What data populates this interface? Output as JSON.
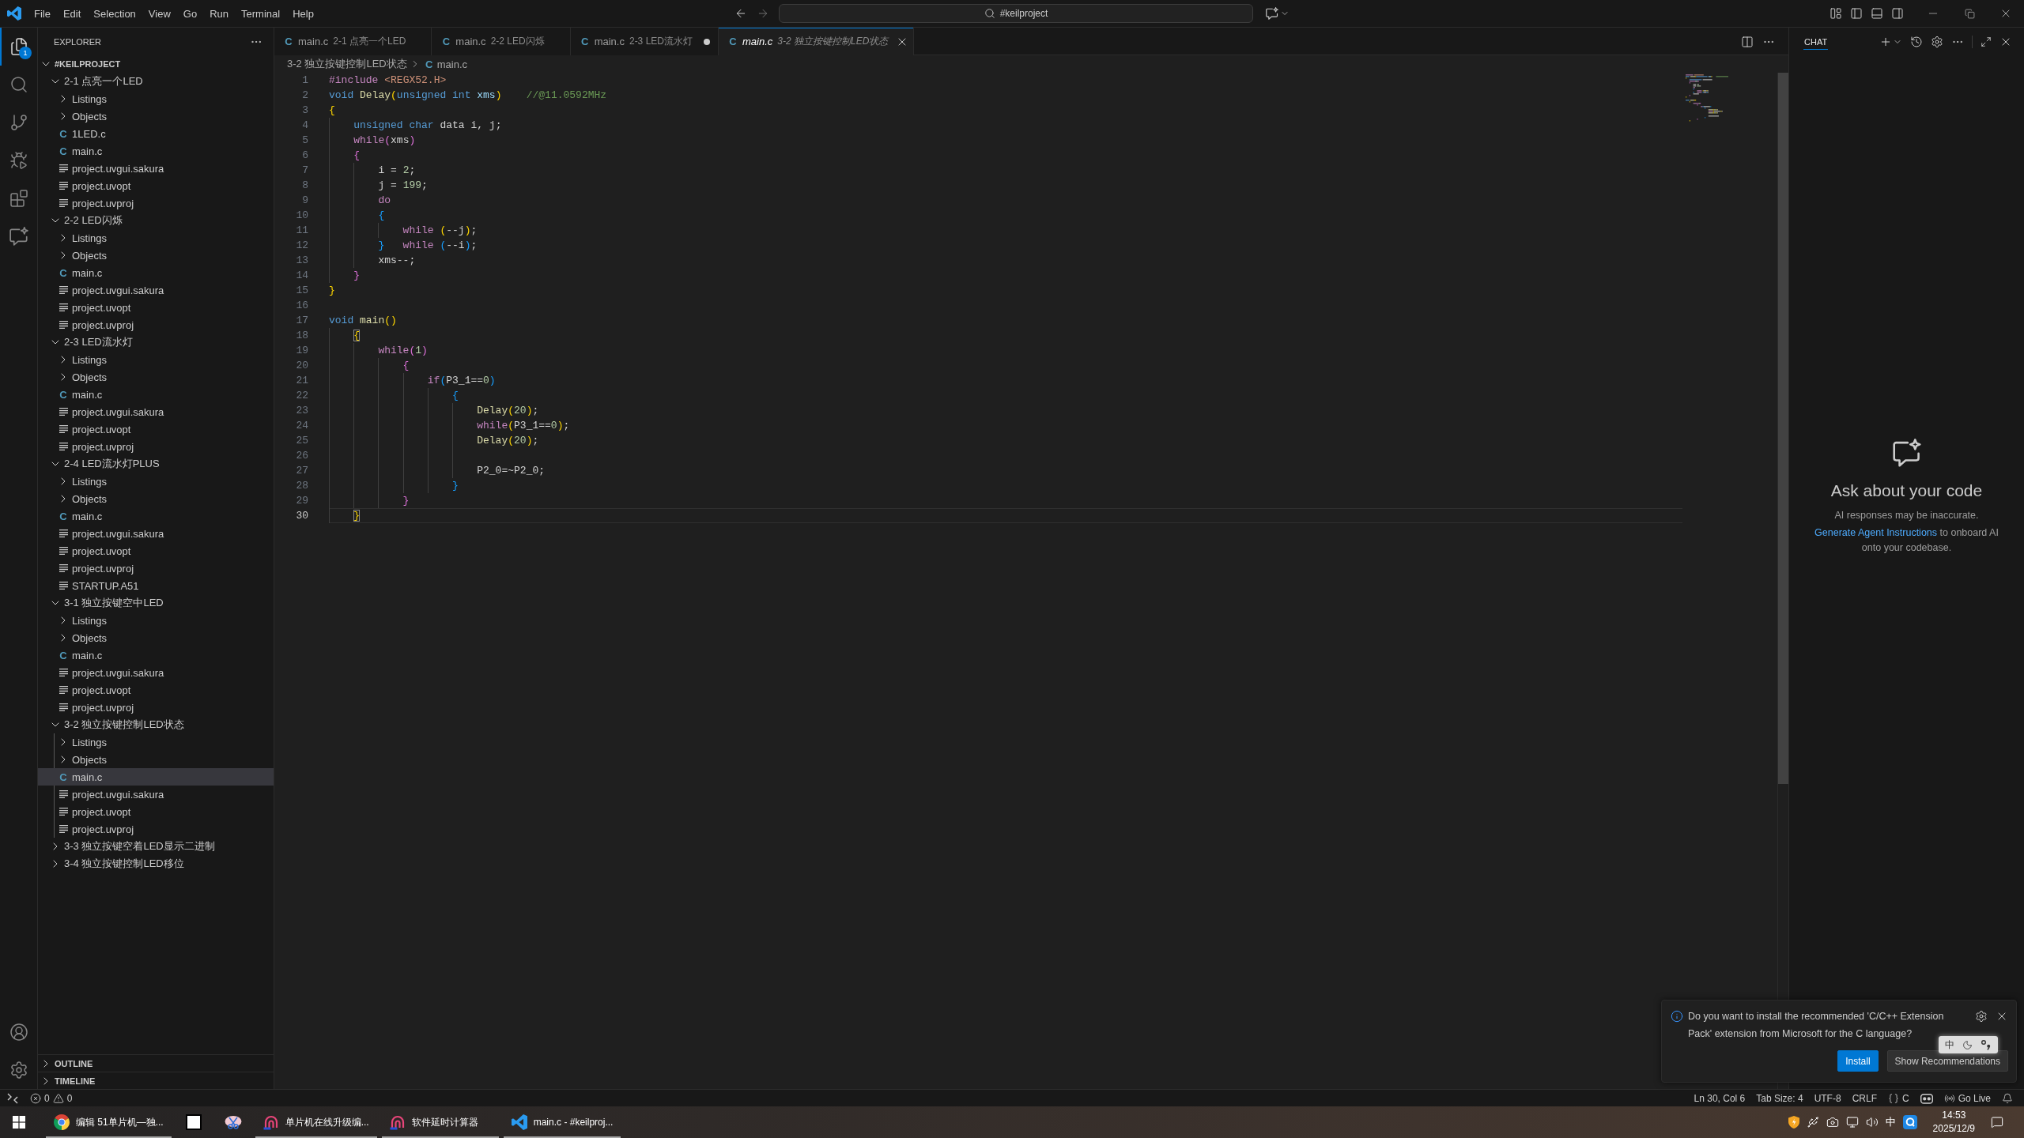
{
  "title_bar": {
    "menu": [
      "File",
      "Edit",
      "Selection",
      "View",
      "Go",
      "Run",
      "Terminal",
      "Help"
    ],
    "command_center": "#keilproject"
  },
  "activity_bar": {
    "items": [
      {
        "kind": "explorer",
        "selected": true,
        "badge": "1"
      },
      {
        "kind": "search",
        "selected": false
      },
      {
        "kind": "scm",
        "selected": false
      },
      {
        "kind": "debug",
        "selected": false
      },
      {
        "kind": "extensions",
        "selected": false
      },
      {
        "kind": "chat",
        "selected": false
      }
    ],
    "bottom": [
      {
        "kind": "account"
      },
      {
        "kind": "settings"
      }
    ]
  },
  "explorer": {
    "title": "EXPLORER",
    "root": {
      "label": "#KEILPROJECT",
      "kind": "workspace",
      "expanded": true,
      "selected": false,
      "children": [
        {
          "label": "2-1 点亮一个LED",
          "kind": "folder",
          "expanded": true,
          "selected": false,
          "children": [
            {
              "label": "Listings",
              "kind": "folder",
              "expanded": false,
              "selected": false
            },
            {
              "label": "Objects",
              "kind": "folder",
              "expanded": false,
              "selected": false
            },
            {
              "label": "1LED.c",
              "kind": "source",
              "icon": "C",
              "selected": false
            },
            {
              "label": "main.c",
              "kind": "source",
              "icon": "C",
              "selected": false
            },
            {
              "label": "project.uvgui.sakura",
              "kind": "file",
              "selected": false
            },
            {
              "label": "project.uvopt",
              "kind": "file",
              "selected": false
            },
            {
              "label": "project.uvproj",
              "kind": "file",
              "selected": false
            }
          ]
        },
        {
          "label": "2-2 LED闪烁",
          "kind": "folder",
          "expanded": true,
          "selected": false,
          "children": [
            {
              "label": "Listings",
              "kind": "folder",
              "expanded": false,
              "selected": false
            },
            {
              "label": "Objects",
              "kind": "folder",
              "expanded": false,
              "selected": false
            },
            {
              "label": "main.c",
              "kind": "source",
              "icon": "C",
              "selected": false
            },
            {
              "label": "project.uvgui.sakura",
              "kind": "file",
              "selected": false
            },
            {
              "label": "project.uvopt",
              "kind": "file",
              "selected": false
            },
            {
              "label": "project.uvproj",
              "kind": "file",
              "selected": false
            }
          ]
        },
        {
          "label": "2-3 LED流水灯",
          "kind": "folder",
          "expanded": true,
          "selected": false,
          "children": [
            {
              "label": "Listings",
              "kind": "folder",
              "expanded": false,
              "selected": false
            },
            {
              "label": "Objects",
              "kind": "folder",
              "expanded": false,
              "selected": false
            },
            {
              "label": "main.c",
              "kind": "source",
              "icon": "C",
              "selected": false
            },
            {
              "label": "project.uvgui.sakura",
              "kind": "file",
              "selected": false
            },
            {
              "label": "project.uvopt",
              "kind": "file",
              "selected": false
            },
            {
              "label": "project.uvproj",
              "kind": "file",
              "selected": false
            }
          ]
        },
        {
          "label": "2-4 LED流水灯PLUS",
          "kind": "folder",
          "expanded": true,
          "selected": false,
          "children": [
            {
              "label": "Listings",
              "kind": "folder",
              "expanded": false,
              "selected": false
            },
            {
              "label": "Objects",
              "kind": "folder",
              "expanded": false,
              "selected": false
            },
            {
              "label": "main.c",
              "kind": "source",
              "icon": "C",
              "selected": false
            },
            {
              "label": "project.uvgui.sakura",
              "kind": "file",
              "selected": false
            },
            {
              "label": "project.uvopt",
              "kind": "file",
              "selected": false
            },
            {
              "label": "project.uvproj",
              "kind": "file",
              "selected": false
            },
            {
              "label": "STARTUP.A51",
              "kind": "file",
              "selected": false
            }
          ]
        },
        {
          "label": "3-1 独立按键空中LED",
          "kind": "folder",
          "expanded": true,
          "selected": false,
          "children": [
            {
              "label": "Listings",
              "kind": "folder",
              "expanded": false,
              "selected": false
            },
            {
              "label": "Objects",
              "kind": "folder",
              "expanded": false,
              "selected": false
            },
            {
              "label": "main.c",
              "kind": "source",
              "icon": "C",
              "selected": false
            },
            {
              "label": "project.uvgui.sakura",
              "kind": "file",
              "selected": false
            },
            {
              "label": "project.uvopt",
              "kind": "file",
              "selected": false
            },
            {
              "label": "project.uvproj",
              "kind": "file",
              "selected": false
            }
          ]
        },
        {
          "label": "3-2 独立按键控制LED状态",
          "kind": "folder",
          "expanded": true,
          "selected": false,
          "children": [
            {
              "label": "Listings",
              "kind": "folder",
              "expanded": false,
              "selected": false
            },
            {
              "label": "Objects",
              "kind": "folder",
              "expanded": false,
              "selected": false
            },
            {
              "label": "main.c",
              "kind": "source",
              "icon": "C",
              "selected": true
            },
            {
              "label": "project.uvgui.sakura",
              "kind": "file",
              "selected": false
            },
            {
              "label": "project.uvopt",
              "kind": "file",
              "selected": false
            },
            {
              "label": "project.uvproj",
              "kind": "file",
              "selected": false
            }
          ]
        },
        {
          "label": "3-3 独立按键空着LED显示二进制",
          "kind": "folder",
          "expanded": false,
          "selected": false
        },
        {
          "label": "3-4 独立按键控制LED移位",
          "kind": "folder",
          "expanded": false,
          "selected": false
        }
      ]
    },
    "sections": [
      {
        "label": "OUTLINE",
        "expanded": false
      },
      {
        "label": "TIMELINE",
        "expanded": false
      }
    ]
  },
  "editor": {
    "tabs": [
      {
        "icon": "C",
        "name": "main.c",
        "description": "2-1 点亮一个LED",
        "selected": false,
        "modified": false,
        "preview": false
      },
      {
        "icon": "C",
        "name": "main.c",
        "description": "2-2 LED闪烁",
        "selected": false,
        "modified": false,
        "preview": false
      },
      {
        "icon": "C",
        "name": "main.c",
        "description": "2-3 LED流水灯",
        "selected": false,
        "modified": true,
        "preview": false
      },
      {
        "icon": "C",
        "name": "main.c",
        "description": "3-2 独立按键控制LED状态",
        "selected": true,
        "modified": false,
        "preview": true
      }
    ],
    "breadcrumbs": [
      {
        "label": "3-2 独立按键控制LED状态"
      },
      {
        "label": "main.c",
        "icon": "C"
      }
    ],
    "lines": [
      {
        "number": "1",
        "selected": false,
        "tokens": [
          {
            "text": "#include",
            "kind": "control"
          },
          {
            "text": " <REGX52.H>",
            "kind": "string"
          }
        ]
      },
      {
        "number": "2",
        "selected": false,
        "tokens": [
          {
            "text": "void ",
            "kind": "keyword"
          },
          {
            "text": "Delay",
            "kind": "function"
          },
          {
            "text": "(",
            "kind": "bracket1"
          },
          {
            "text": "unsigned int ",
            "kind": "keyword"
          },
          {
            "text": "xms",
            "kind": "param"
          },
          {
            "text": ")",
            "kind": "bracket1"
          },
          {
            "text": "    //@11.0592MHz",
            "kind": "comment"
          }
        ]
      },
      {
        "number": "3",
        "selected": false,
        "tokens": [
          {
            "text": "{",
            "kind": "bracket1"
          }
        ]
      },
      {
        "number": "4",
        "selected": false,
        "tokens": [
          {
            "text": "    unsigned char",
            "kind": "keyword"
          },
          {
            "text": " data i, j;",
            "kind": "plain"
          }
        ]
      },
      {
        "number": "5",
        "selected": false,
        "tokens": [
          {
            "text": "    while",
            "kind": "control"
          },
          {
            "text": "(",
            "kind": "bracket2"
          },
          {
            "text": "xms",
            "kind": "plain"
          },
          {
            "text": ")",
            "kind": "bracket2"
          }
        ]
      },
      {
        "number": "6",
        "selected": false,
        "tokens": [
          {
            "text": "    {",
            "kind": "bracket2"
          }
        ]
      },
      {
        "number": "7",
        "selected": false,
        "tokens": [
          {
            "text": "        i = ",
            "kind": "plain"
          },
          {
            "text": "2",
            "kind": "number"
          },
          {
            "text": ";",
            "kind": "plain"
          }
        ]
      },
      {
        "number": "8",
        "selected": false,
        "tokens": [
          {
            "text": "        j = ",
            "kind": "plain"
          },
          {
            "text": "199",
            "kind": "number"
          },
          {
            "text": ";",
            "kind": "plain"
          }
        ]
      },
      {
        "number": "9",
        "selected": false,
        "tokens": [
          {
            "text": "        do",
            "kind": "control"
          }
        ]
      },
      {
        "number": "10",
        "selected": false,
        "tokens": [
          {
            "text": "        {",
            "kind": "bracket3"
          }
        ]
      },
      {
        "number": "11",
        "selected": false,
        "tokens": [
          {
            "text": "            while ",
            "kind": "control"
          },
          {
            "text": "(",
            "kind": "bracket1"
          },
          {
            "text": "--j",
            "kind": "plain"
          },
          {
            "text": ")",
            "kind": "bracket1"
          },
          {
            "text": ";",
            "kind": "plain"
          }
        ]
      },
      {
        "number": "12",
        "selected": false,
        "tokens": [
          {
            "text": "        }",
            "kind": "bracket3"
          },
          {
            "text": "   while ",
            "kind": "control"
          },
          {
            "text": "(",
            "kind": "bracket3"
          },
          {
            "text": "--i",
            "kind": "plain"
          },
          {
            "text": ")",
            "kind": "bracket3"
          },
          {
            "text": ";",
            "kind": "plain"
          }
        ]
      },
      {
        "number": "13",
        "selected": false,
        "tokens": [
          {
            "text": "        xms--;",
            "kind": "plain"
          }
        ]
      },
      {
        "number": "14",
        "selected": false,
        "tokens": [
          {
            "text": "    }",
            "kind": "bracket2"
          }
        ]
      },
      {
        "number": "15",
        "selected": false,
        "tokens": [
          {
            "text": "}",
            "kind": "bracket1"
          }
        ]
      },
      {
        "number": "16",
        "selected": false
      },
      {
        "number": "17",
        "selected": false,
        "tokens": [
          {
            "text": "void ",
            "kind": "keyword"
          },
          {
            "text": "main",
            "kind": "function"
          },
          {
            "text": "()",
            "kind": "bracket1"
          }
        ]
      },
      {
        "number": "18",
        "selected": false,
        "tokens": [
          {
            "text": "    {",
            "kind": "bracketmatch"
          }
        ]
      },
      {
        "number": "19",
        "selected": false,
        "tokens": [
          {
            "text": "        while",
            "kind": "control"
          },
          {
            "text": "(",
            "kind": "bracket2"
          },
          {
            "text": "1",
            "kind": "number"
          },
          {
            "text": ")",
            "kind": "bracket2"
          }
        ]
      },
      {
        "number": "20",
        "selected": false,
        "tokens": [
          {
            "text": "            {",
            "kind": "bracket2"
          }
        ]
      },
      {
        "number": "21",
        "selected": false,
        "tokens": [
          {
            "text": "                if",
            "kind": "control"
          },
          {
            "text": "(",
            "kind": "bracket3"
          },
          {
            "text": "P3_1==",
            "kind": "plain"
          },
          {
            "text": "0",
            "kind": "number"
          },
          {
            "text": ")",
            "kind": "bracket3"
          }
        ]
      },
      {
        "number": "22",
        "selected": false,
        "tokens": [
          {
            "text": "                    {",
            "kind": "bracket3"
          }
        ]
      },
      {
        "number": "23",
        "selected": false,
        "tokens": [
          {
            "text": "                        Delay",
            "kind": "function"
          },
          {
            "text": "(",
            "kind": "bracket1"
          },
          {
            "text": "20",
            "kind": "number"
          },
          {
            "text": ")",
            "kind": "bracket1"
          },
          {
            "text": ";",
            "kind": "plain"
          }
        ]
      },
      {
        "number": "24",
        "selected": false,
        "tokens": [
          {
            "text": "                        while",
            "kind": "control"
          },
          {
            "text": "(",
            "kind": "bracket1"
          },
          {
            "text": "P3_1==",
            "kind": "plain"
          },
          {
            "text": "0",
            "kind": "number"
          },
          {
            "text": ")",
            "kind": "bracket1"
          },
          {
            "text": ";",
            "kind": "plain"
          }
        ]
      },
      {
        "number": "25",
        "selected": false,
        "tokens": [
          {
            "text": "                        Delay",
            "kind": "function"
          },
          {
            "text": "(",
            "kind": "bracket1"
          },
          {
            "text": "20",
            "kind": "number"
          },
          {
            "text": ")",
            "kind": "bracket1"
          },
          {
            "text": ";",
            "kind": "plain"
          }
        ]
      },
      {
        "number": "26",
        "selected": false
      },
      {
        "number": "27",
        "selected": false,
        "tokens": [
          {
            "text": "                        P2_0=~P2_0;",
            "kind": "plain"
          }
        ]
      },
      {
        "number": "28",
        "selected": false,
        "tokens": [
          {
            "text": "                    }",
            "kind": "bracket3"
          }
        ]
      },
      {
        "number": "29",
        "selected": false,
        "tokens": [
          {
            "text": "            }",
            "kind": "bracket2"
          }
        ]
      },
      {
        "number": "30",
        "selected": true,
        "tokens": [
          {
            "text": "    }",
            "kind": "bracketmatch"
          }
        ]
      }
    ]
  },
  "chat": {
    "tabs": [
      {
        "label": "CHAT",
        "selected": true
      }
    ],
    "heading": "Ask about your code",
    "disclaimer": "AI responses may be inaccurate.",
    "hint": {
      "link": "Generate Agent Instructions",
      "text": " to onboard AI onto your codebase."
    }
  },
  "notification": {
    "message_lines": [
      "Do you want to install the recommended 'C/C++ Extension",
      "Pack' extension from Microsoft for the C language?"
    ],
    "buttons": [
      {
        "label": "Install",
        "kind": "primary"
      },
      {
        "label": "Show Recommendations",
        "kind": "secondary"
      }
    ]
  },
  "ime_toolbar": {
    "mode": "中"
  },
  "status_bar": {
    "problems": {
      "errors": "0",
      "warnings": "0"
    },
    "items": [
      {
        "kind": "text",
        "label": "Ln 30, Col 6"
      },
      {
        "kind": "text",
        "label": "Tab Size: 4"
      },
      {
        "kind": "text",
        "label": "UTF-8"
      },
      {
        "kind": "text",
        "label": "CRLF"
      },
      {
        "kind": "language",
        "label": "C"
      },
      {
        "kind": "assistant"
      },
      {
        "kind": "live",
        "label": "Go Live"
      },
      {
        "kind": "bell"
      }
    ]
  },
  "taskbar": {
    "apps": [
      {
        "kind": "browser",
        "label": "编辑 51单片机—独...",
        "running": true
      },
      {
        "kind": "square",
        "running": false
      },
      {
        "kind": "snip",
        "running": false
      },
      {
        "kind": "tool",
        "label": "单片机在线升级编...",
        "running": true
      },
      {
        "kind": "tool",
        "label": "软件延时计算器",
        "running": true
      },
      {
        "kind": "editor",
        "label": "main.c - #keilproj...",
        "running": true
      }
    ],
    "tray": [
      {
        "kind": "shield"
      },
      {
        "kind": "usb"
      },
      {
        "kind": "camera"
      },
      {
        "kind": "network"
      },
      {
        "kind": "volume"
      },
      {
        "kind": "ime",
        "label": "中"
      },
      {
        "kind": "qapp"
      }
    ],
    "time": "14:53",
    "date": "2025/12/9"
  }
}
